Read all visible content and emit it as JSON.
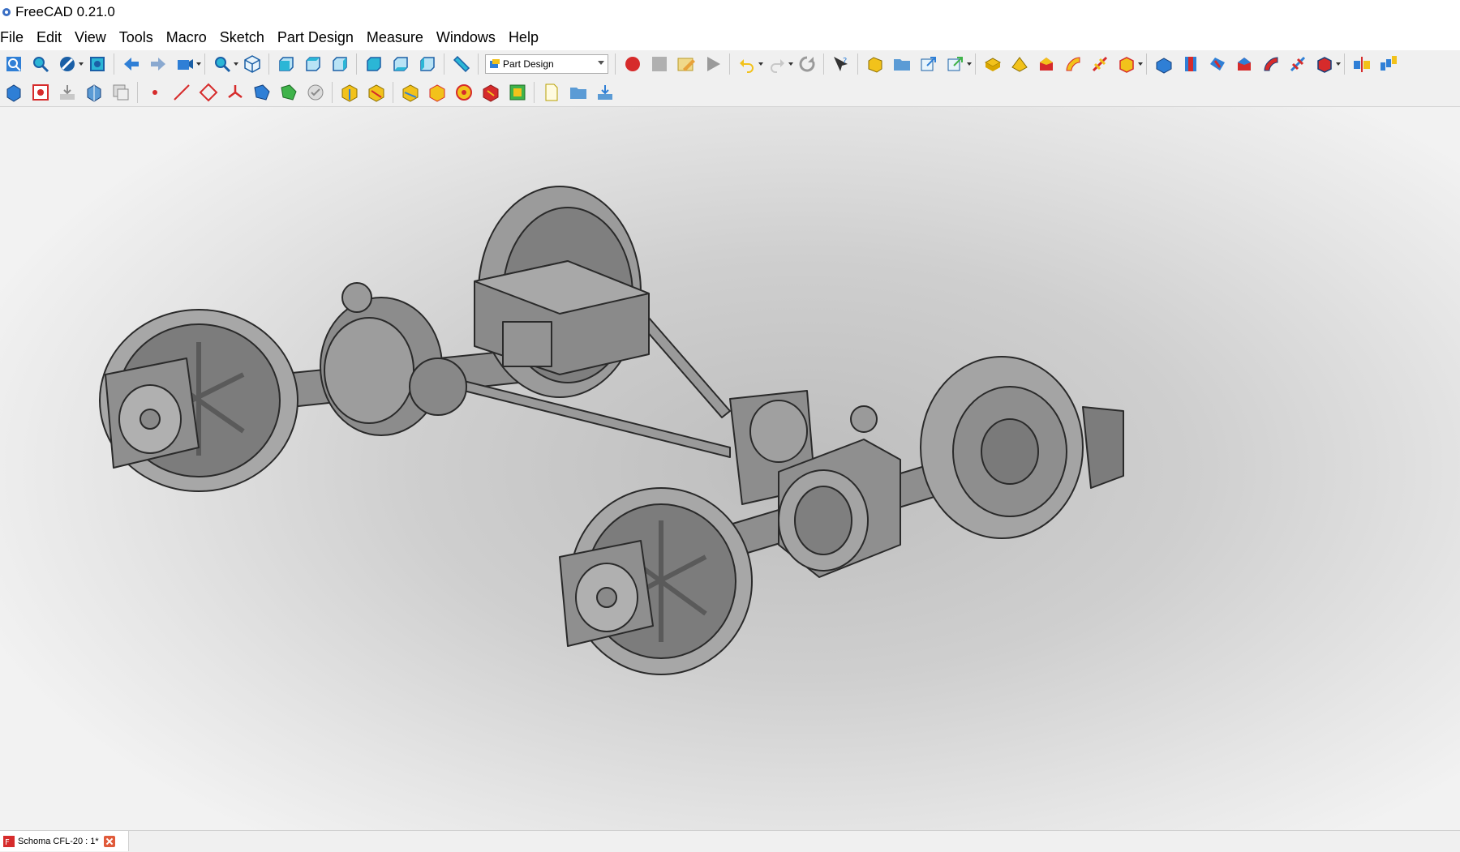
{
  "window": {
    "title": "FreeCAD 0.21.0",
    "app_icon": "freecad-gear-icon"
  },
  "menu": [
    "File",
    "Edit",
    "View",
    "Tools",
    "Macro",
    "Sketch",
    "Part Design",
    "Measure",
    "Windows",
    "Help"
  ],
  "toolbar": {
    "workbench_selected": "Part Design",
    "colors": {
      "blue": "#2f7fd6",
      "cyan": "#2bb6d6",
      "yellow": "#f2c21b",
      "red": "#d62b2b",
      "green": "#3fb34a",
      "gray": "#8a8a8a"
    }
  },
  "tabs": [
    {
      "title": "Schoma CFL-20 : 1*",
      "icon": "freecad-document-icon",
      "close_icon": "close-icon"
    }
  ],
  "viewport": {
    "model": "3d-bogie-model"
  }
}
